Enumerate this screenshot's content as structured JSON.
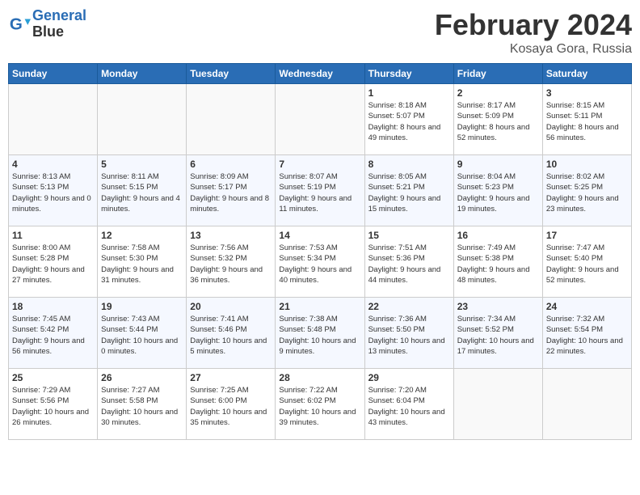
{
  "logo": {
    "line1": "General",
    "line2": "Blue"
  },
  "title": "February 2024",
  "location": "Kosaya Gora, Russia",
  "days_of_week": [
    "Sunday",
    "Monday",
    "Tuesday",
    "Wednesday",
    "Thursday",
    "Friday",
    "Saturday"
  ],
  "weeks": [
    [
      {
        "num": "",
        "sunrise": "",
        "sunset": "",
        "daylight": ""
      },
      {
        "num": "",
        "sunrise": "",
        "sunset": "",
        "daylight": ""
      },
      {
        "num": "",
        "sunrise": "",
        "sunset": "",
        "daylight": ""
      },
      {
        "num": "",
        "sunrise": "",
        "sunset": "",
        "daylight": ""
      },
      {
        "num": "1",
        "sunrise": "8:18 AM",
        "sunset": "5:07 PM",
        "daylight": "8 hours and 49 minutes."
      },
      {
        "num": "2",
        "sunrise": "8:17 AM",
        "sunset": "5:09 PM",
        "daylight": "8 hours and 52 minutes."
      },
      {
        "num": "3",
        "sunrise": "8:15 AM",
        "sunset": "5:11 PM",
        "daylight": "8 hours and 56 minutes."
      }
    ],
    [
      {
        "num": "4",
        "sunrise": "8:13 AM",
        "sunset": "5:13 PM",
        "daylight": "9 hours and 0 minutes."
      },
      {
        "num": "5",
        "sunrise": "8:11 AM",
        "sunset": "5:15 PM",
        "daylight": "9 hours and 4 minutes."
      },
      {
        "num": "6",
        "sunrise": "8:09 AM",
        "sunset": "5:17 PM",
        "daylight": "9 hours and 8 minutes."
      },
      {
        "num": "7",
        "sunrise": "8:07 AM",
        "sunset": "5:19 PM",
        "daylight": "9 hours and 11 minutes."
      },
      {
        "num": "8",
        "sunrise": "8:05 AM",
        "sunset": "5:21 PM",
        "daylight": "9 hours and 15 minutes."
      },
      {
        "num": "9",
        "sunrise": "8:04 AM",
        "sunset": "5:23 PM",
        "daylight": "9 hours and 19 minutes."
      },
      {
        "num": "10",
        "sunrise": "8:02 AM",
        "sunset": "5:25 PM",
        "daylight": "9 hours and 23 minutes."
      }
    ],
    [
      {
        "num": "11",
        "sunrise": "8:00 AM",
        "sunset": "5:28 PM",
        "daylight": "9 hours and 27 minutes."
      },
      {
        "num": "12",
        "sunrise": "7:58 AM",
        "sunset": "5:30 PM",
        "daylight": "9 hours and 31 minutes."
      },
      {
        "num": "13",
        "sunrise": "7:56 AM",
        "sunset": "5:32 PM",
        "daylight": "9 hours and 36 minutes."
      },
      {
        "num": "14",
        "sunrise": "7:53 AM",
        "sunset": "5:34 PM",
        "daylight": "9 hours and 40 minutes."
      },
      {
        "num": "15",
        "sunrise": "7:51 AM",
        "sunset": "5:36 PM",
        "daylight": "9 hours and 44 minutes."
      },
      {
        "num": "16",
        "sunrise": "7:49 AM",
        "sunset": "5:38 PM",
        "daylight": "9 hours and 48 minutes."
      },
      {
        "num": "17",
        "sunrise": "7:47 AM",
        "sunset": "5:40 PM",
        "daylight": "9 hours and 52 minutes."
      }
    ],
    [
      {
        "num": "18",
        "sunrise": "7:45 AM",
        "sunset": "5:42 PM",
        "daylight": "9 hours and 56 minutes."
      },
      {
        "num": "19",
        "sunrise": "7:43 AM",
        "sunset": "5:44 PM",
        "daylight": "10 hours and 0 minutes."
      },
      {
        "num": "20",
        "sunrise": "7:41 AM",
        "sunset": "5:46 PM",
        "daylight": "10 hours and 5 minutes."
      },
      {
        "num": "21",
        "sunrise": "7:38 AM",
        "sunset": "5:48 PM",
        "daylight": "10 hours and 9 minutes."
      },
      {
        "num": "22",
        "sunrise": "7:36 AM",
        "sunset": "5:50 PM",
        "daylight": "10 hours and 13 minutes."
      },
      {
        "num": "23",
        "sunrise": "7:34 AM",
        "sunset": "5:52 PM",
        "daylight": "10 hours and 17 minutes."
      },
      {
        "num": "24",
        "sunrise": "7:32 AM",
        "sunset": "5:54 PM",
        "daylight": "10 hours and 22 minutes."
      }
    ],
    [
      {
        "num": "25",
        "sunrise": "7:29 AM",
        "sunset": "5:56 PM",
        "daylight": "10 hours and 26 minutes."
      },
      {
        "num": "26",
        "sunrise": "7:27 AM",
        "sunset": "5:58 PM",
        "daylight": "10 hours and 30 minutes."
      },
      {
        "num": "27",
        "sunrise": "7:25 AM",
        "sunset": "6:00 PM",
        "daylight": "10 hours and 35 minutes."
      },
      {
        "num": "28",
        "sunrise": "7:22 AM",
        "sunset": "6:02 PM",
        "daylight": "10 hours and 39 minutes."
      },
      {
        "num": "29",
        "sunrise": "7:20 AM",
        "sunset": "6:04 PM",
        "daylight": "10 hours and 43 minutes."
      },
      {
        "num": "",
        "sunrise": "",
        "sunset": "",
        "daylight": ""
      },
      {
        "num": "",
        "sunrise": "",
        "sunset": "",
        "daylight": ""
      }
    ]
  ]
}
